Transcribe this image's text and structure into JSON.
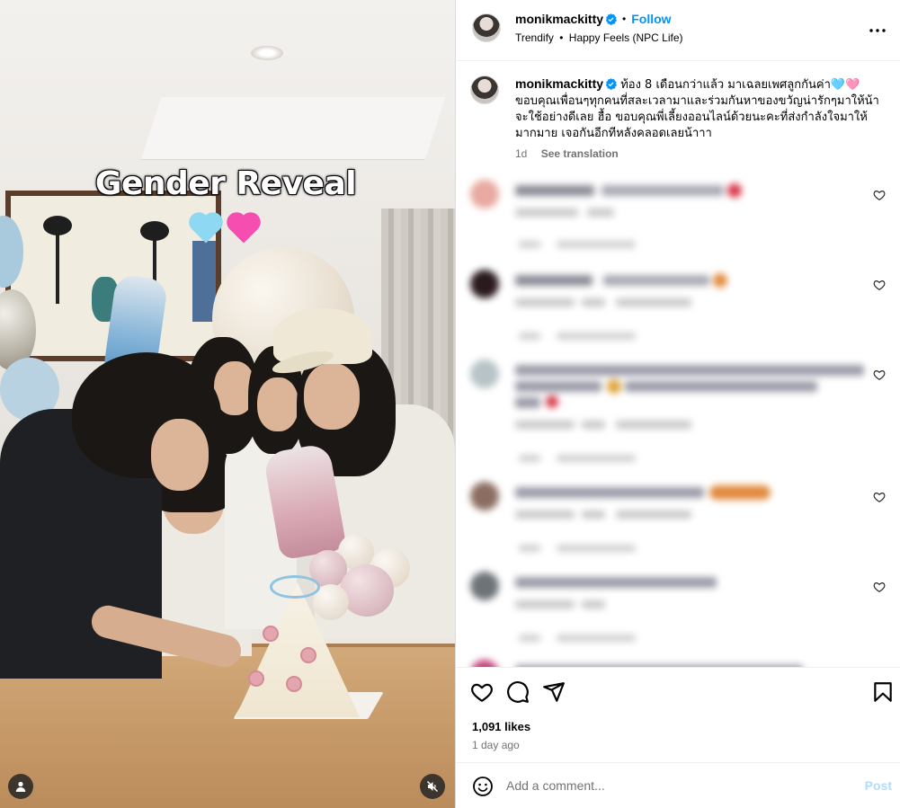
{
  "post": {
    "media": {
      "overlay_title": "Gender Reveal",
      "overlay_hearts": [
        "blue-heart",
        "pink-heart"
      ],
      "icons": {
        "user_tag": "user-tag-icon",
        "mute": "muted-audio-icon"
      }
    },
    "header": {
      "username": "monikmackitty",
      "verified_icon": "verified-badge-icon",
      "separator": "•",
      "follow_label": "Follow",
      "audio_artist": "Trendify",
      "audio_separator": "•",
      "audio_track": "Happy Feels (NPC Life)",
      "more_icon": "more-options-icon"
    },
    "caption": {
      "username": "monikmackitty",
      "text": "ท้อง 8 เดือนกว่าแล้ว มาเฉลยเพศลูกกันค่า🩵🩷 ขอบคุณเพื่อนๆทุกคนที่สละเวลามาและร่วมกันหาของขวัญน่ารักๆมาให้น้า จะใช้อย่างดีเลย ฮื้อ ขอบคุณพี่เลี้ยงออนไลน์ด้วยนะคะที่ส่งกำลังใจมาให้มากมาย เจอกันอีกทีหลังคลอดเลยน้าาา",
      "time": "1d",
      "see_translation": "See translation"
    },
    "comments": [
      {
        "avatar_color": "#e7a9a0",
        "line_color": "#9a9aa8",
        "emoji_color": "#d8394a"
      },
      {
        "avatar_color": "#2a1a1e",
        "line_color": "#9a9aa8",
        "emoji_color": "#e28a3c"
      },
      {
        "avatar_color": "#b7c3c7",
        "line_color": "#9a9aa8",
        "emoji_color": "#e0a43a"
      },
      {
        "avatar_color": "#8c6d62",
        "line_color": "#9a9aa8",
        "emoji_color": "#e08a3c"
      },
      {
        "avatar_color": "#6e7378",
        "line_color": "#9a9aa8",
        "emoji_color": "#9a9aa8"
      },
      {
        "avatar_color": "#c6457f",
        "line_color": "#9a9aa8",
        "emoji_color": "#9a9aa8"
      }
    ],
    "actions": {
      "like_icon": "heart-icon",
      "comment_icon": "comment-icon",
      "share_icon": "share-icon",
      "save_icon": "bookmark-icon"
    },
    "likes": "1,091 likes",
    "date": "1 day ago",
    "add_comment": {
      "emoji_icon": "emoji-icon",
      "placeholder": "Add a comment...",
      "post_label": "Post"
    }
  },
  "colors": {
    "link_blue": "#0095f6",
    "post_disabled": "#b3dbff",
    "meta_gray": "#737373",
    "border": "#dbdbdb"
  }
}
